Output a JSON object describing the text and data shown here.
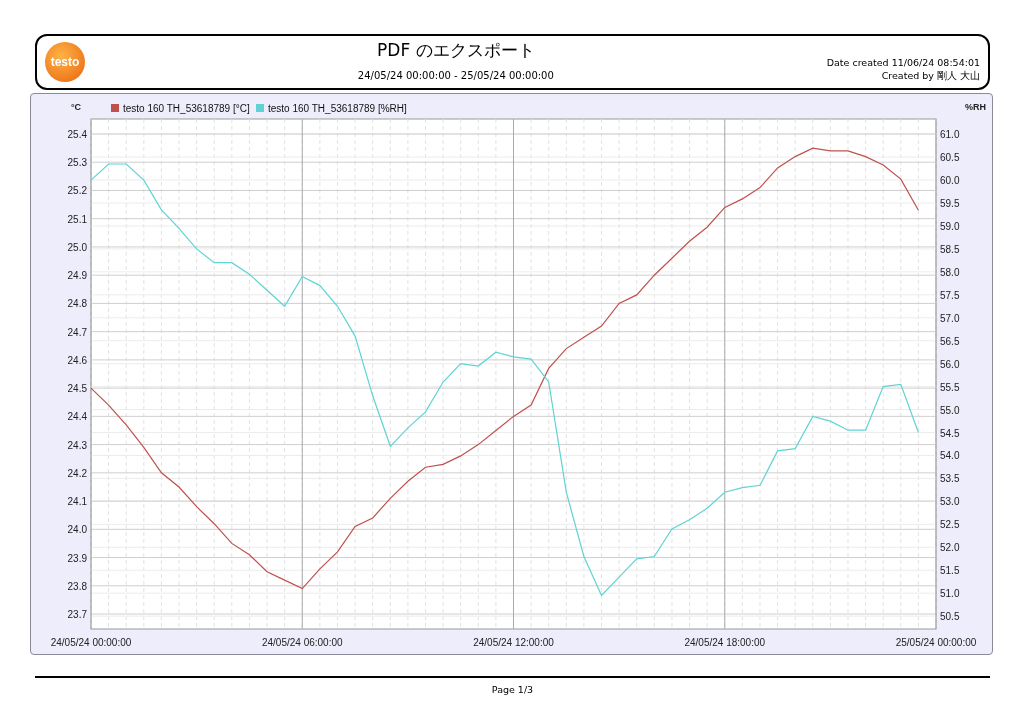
{
  "header": {
    "logo": "testo",
    "title": "PDF のエクスポート",
    "range": "24/05/24 00:00:00 - 25/05/24 00:00:00",
    "date_created": "Date created 11/06/24 08:54:01",
    "created_by": "Created by 剛人 大山"
  },
  "chart": {
    "chart_data": {
      "type": "line",
      "grid": true,
      "legend": "top",
      "ylabel": "°C",
      "y2label": "%RH",
      "categories": [
        "24/05/24 00:00:00",
        null,
        null,
        null,
        null,
        null,
        null,
        null,
        null,
        null,
        null,
        null,
        "24/05/24 06:00:00",
        null,
        null,
        null,
        null,
        null,
        null,
        null,
        null,
        null,
        null,
        null,
        "24/05/24 12:00:00",
        null,
        null,
        null,
        null,
        null,
        null,
        null,
        null,
        null,
        null,
        null,
        "24/05/24 18:00:00",
        null,
        null,
        null,
        null,
        null,
        null,
        null,
        null,
        null,
        null,
        null,
        "25/05/24 00:00:00"
      ],
      "ylim": [
        23.647,
        25.453
      ],
      "yticks": [
        23.7,
        23.8,
        23.9,
        {
          "value": 24,
          "label": "24.0"
        },
        24.1,
        24.2,
        24.3,
        24.4,
        24.5,
        24.6,
        24.7,
        24.8,
        24.9,
        {
          "value": 25,
          "label": "25.0"
        },
        25.1,
        25.2,
        25.3,
        25.4
      ],
      "y2lim": [
        50.22,
        61.33
      ],
      "y2ticks": [
        50.5,
        {
          "value": 51,
          "label": "51.0"
        },
        51.5,
        {
          "value": 52,
          "label": "52.0"
        },
        52.5,
        {
          "value": 53,
          "label": "53.0"
        },
        53.5,
        {
          "value": 54,
          "label": "54.0"
        },
        54.5,
        {
          "value": 55,
          "label": "55.0"
        },
        55.5,
        {
          "value": 56,
          "label": "56.0"
        },
        56.5,
        {
          "value": 57,
          "label": "57.0"
        },
        57.5,
        {
          "value": 58,
          "label": "58.0"
        },
        58.5,
        {
          "value": 59,
          "label": "59.0"
        },
        59.5,
        {
          "value": 60,
          "label": "60.0"
        },
        60.5,
        {
          "value": 61,
          "label": "61.0"
        }
      ],
      "series": [
        {
          "name": "testo 160 TH_53618789 [°C]",
          "color": "#c0504d",
          "axis": "y",
          "values": [
            24.5,
            24.44,
            24.37,
            24.29,
            24.2,
            24.15,
            24.08,
            24.02,
            23.95,
            23.91,
            23.85,
            23.82,
            23.79,
            23.86,
            23.92,
            24.01,
            24.04,
            24.11,
            24.17,
            24.22,
            24.23,
            24.26,
            24.3,
            24.35,
            24.4,
            24.44,
            24.57,
            24.64,
            24.68,
            24.72,
            24.8,
            24.83,
            24.9,
            24.96,
            25.02,
            25.07,
            25.14,
            25.17,
            25.21,
            25.28,
            25.32,
            25.35,
            25.34,
            25.34,
            25.32,
            25.29,
            25.24,
            25.13,
            null
          ]
        },
        {
          "name": "testo 160 TH_53618789 [%RH]",
          "color": "#5fd3d3",
          "axis": "y2",
          "values": [
            60.0,
            60.35,
            60.35,
            60.0,
            59.35,
            58.95,
            58.5,
            58.2,
            58.2,
            57.95,
            57.6,
            57.25,
            57.9,
            57.7,
            57.25,
            56.6,
            55.3,
            54.2,
            54.6,
            54.95,
            55.6,
            56.0,
            55.95,
            56.25,
            56.15,
            56.1,
            55.6,
            53.2,
            51.8,
            50.95,
            51.35,
            51.75,
            51.8,
            52.4,
            52.6,
            52.85,
            53.2,
            53.3,
            53.35,
            54.1,
            54.15,
            54.85,
            54.75,
            54.55,
            54.55,
            55.5,
            55.55,
            54.5,
            null
          ]
        }
      ]
    }
  },
  "footer": {
    "page": "Page 1/3"
  }
}
